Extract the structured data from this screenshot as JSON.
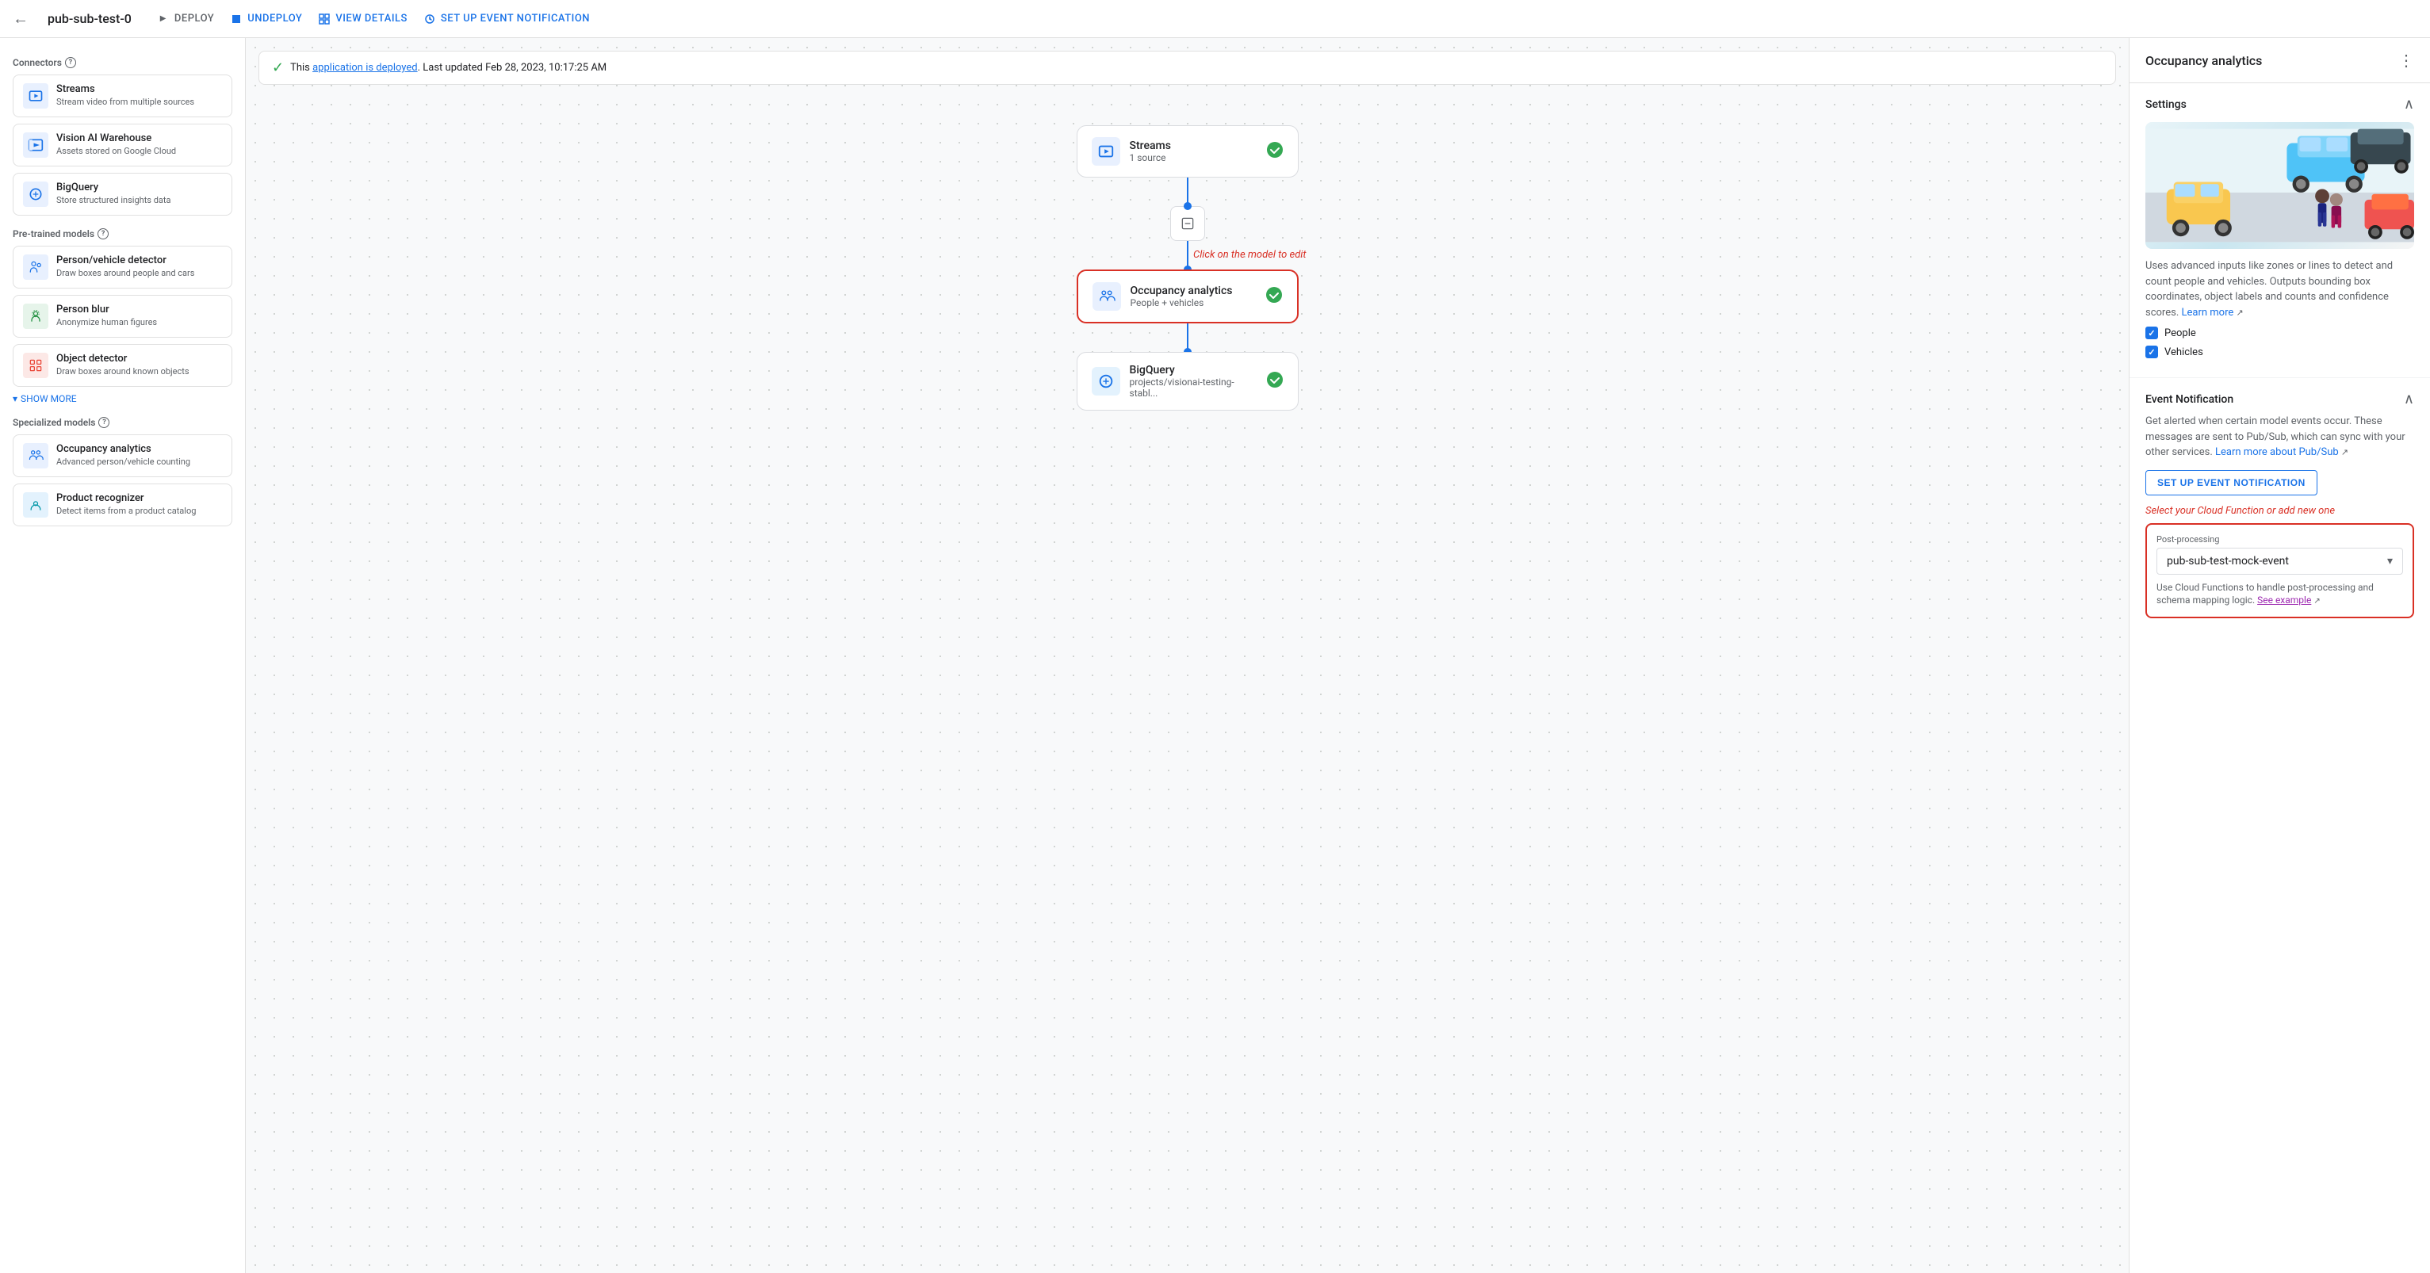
{
  "topbar": {
    "back_icon": "←",
    "title": "pub-sub-test-0",
    "actions": [
      {
        "id": "deploy",
        "label": "DEPLOY",
        "icon": "▶",
        "color": "gray"
      },
      {
        "id": "undeploy",
        "label": "UNDEPLOY",
        "icon": "■",
        "color": "blue"
      },
      {
        "id": "view-details",
        "label": "VIEW DETAILS",
        "icon": "⊞",
        "color": "blue"
      },
      {
        "id": "setup-event",
        "label": "SET UP EVENT NOTIFICATION",
        "icon": "✦",
        "color": "blue"
      }
    ]
  },
  "status": {
    "icon": "✓",
    "text_prefix": "This ",
    "link_text": "application is deployed",
    "text_suffix": ". Last updated Feb 28, 2023, 10:17:25 AM"
  },
  "sidebar": {
    "connectors_label": "Connectors",
    "connectors": [
      {
        "id": "streams",
        "name": "Streams",
        "desc": "Stream video from multiple sources",
        "icon_type": "blue"
      },
      {
        "id": "vision-ai",
        "name": "Vision AI Warehouse",
        "desc": "Assets stored on Google Cloud",
        "icon_type": "blue"
      },
      {
        "id": "bigquery",
        "name": "BigQuery",
        "desc": "Store structured insights data",
        "icon_type": "blue"
      }
    ],
    "pretrained_label": "Pre-trained models",
    "pretrained": [
      {
        "id": "person-vehicle",
        "name": "Person/vehicle detector",
        "desc": "Draw boxes around people and cars",
        "icon_type": "blue"
      },
      {
        "id": "person-blur",
        "name": "Person blur",
        "desc": "Anonymize human figures",
        "icon_type": "teal"
      },
      {
        "id": "object-detector",
        "name": "Object detector",
        "desc": "Draw boxes around known objects",
        "icon_type": "orange"
      }
    ],
    "show_more_label": "SHOW MORE",
    "specialized_label": "Specialized models",
    "specialized": [
      {
        "id": "occupancy",
        "name": "Occupancy analytics",
        "desc": "Advanced person/vehicle counting",
        "icon_type": "blue"
      },
      {
        "id": "product-recognizer",
        "name": "Product recognizer",
        "desc": "Detect items from a product catalog",
        "icon_type": "cyan"
      }
    ]
  },
  "canvas": {
    "nodes": [
      {
        "id": "streams-node",
        "title": "Streams",
        "subtitle": "1 source",
        "type": "streams",
        "checked": true
      },
      {
        "id": "occupancy-node",
        "title": "Occupancy analytics",
        "subtitle": "People + vehicles",
        "type": "occupancy",
        "checked": true,
        "selected": true
      },
      {
        "id": "bigquery-node",
        "title": "BigQuery",
        "subtitle": "projects/visionai-testing-stabl...",
        "type": "bigquery",
        "checked": true
      }
    ],
    "click_hint": "Click on the model to edit"
  },
  "right_panel": {
    "title": "Occupancy analytics",
    "settings_label": "Settings",
    "description": "Uses advanced inputs like zones or lines to detect and count people and vehicles. Outputs bounding box coordinates, object labels and counts and confidence scores.",
    "learn_more_label": "Learn more",
    "checkboxes": [
      {
        "id": "people",
        "label": "People",
        "checked": true
      },
      {
        "id": "vehicles",
        "label": "Vehicles",
        "checked": true
      }
    ],
    "event_notification_label": "Event Notification",
    "event_desc": "Get alerted when certain model events occur. These messages are sent to Pub/Sub, which can sync with your other services.",
    "learn_more_pubsub": "Learn more about Pub/Sub",
    "setup_btn_label": "SET UP EVENT NOTIFICATION",
    "select_hint": "Select your Cloud Function or add new one",
    "dropdown": {
      "label": "Post-processing",
      "value": "pub-sub-test-mock-event",
      "help_text": "Use Cloud Functions to handle post-processing and schema mapping logic.",
      "see_example_label": "See example"
    }
  }
}
